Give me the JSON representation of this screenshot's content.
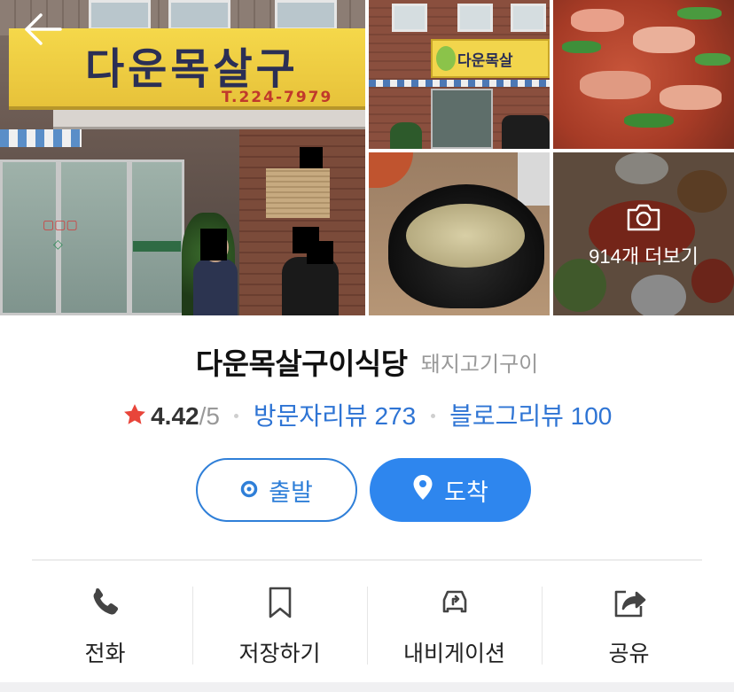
{
  "gallery": {
    "main_sign_name": "다운목살구",
    "main_sign_phone": "T.224-7979",
    "small_sign_name": "다운목살",
    "more_photos_label": "914개 더보기",
    "icons": {
      "back": "arrow-left-icon",
      "camera": "camera-icon"
    }
  },
  "place": {
    "name": "다운목살구이식당",
    "category": "돼지고기구이",
    "rating_value": "4.42",
    "rating_outof": "/5",
    "visitor_reviews": "방문자리뷰 273",
    "blog_reviews": "블로그리뷰 100",
    "star_color": "#e8453a"
  },
  "route": {
    "depart_label": "출발",
    "arrive_label": "도착",
    "accent_color": "#2e86ee"
  },
  "actions": [
    {
      "label": "전화",
      "icon": "phone-icon"
    },
    {
      "label": "저장하기",
      "icon": "bookmark-icon"
    },
    {
      "label": "내비게이션",
      "icon": "navigation-car-icon"
    },
    {
      "label": "공유",
      "icon": "share-icon"
    }
  ]
}
